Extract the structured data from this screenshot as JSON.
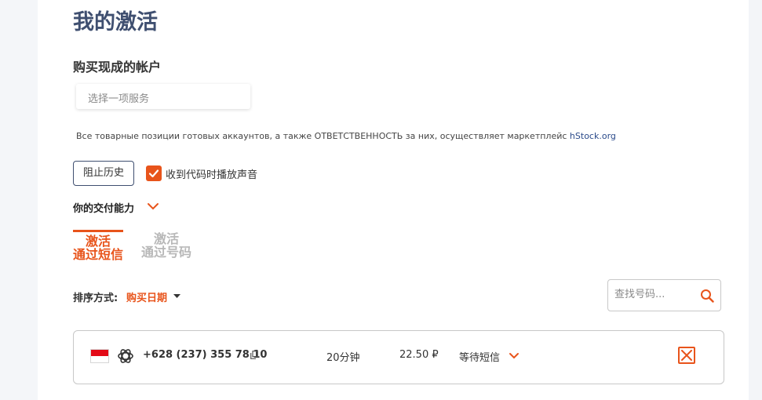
{
  "page": {
    "title": "我的激活",
    "subtitle": "购买现成的帐户",
    "service_select_placeholder": "选择一项服务",
    "notice_text": "Все товарные позиции готовых аккаунтов, а также ОТВЕТСТВЕННОСТЬ за них, осуществляет маркетплейс ",
    "notice_link": "hStock.org",
    "history_button": "阻止历史",
    "sound_checkbox_label": "收到代码时播放声音",
    "sound_checked": true,
    "delivery_ability_label": "你的交付能力"
  },
  "tabs": [
    {
      "line1": "激活",
      "line2": "通过短信",
      "active": true
    },
    {
      "line1": "激活",
      "line2": "通过号码",
      "active": false
    }
  ],
  "sort": {
    "label": "排序方式:",
    "value": "购买日期"
  },
  "search": {
    "placeholder": "查找号码..."
  },
  "activations": [
    {
      "country_flag": "indonesia-flag",
      "service_icon": "openai-icon",
      "phone": "+628 (237) 355 78 10",
      "duration": "20分钟",
      "price": "22.50 ₽",
      "status": "等待短信"
    }
  ],
  "colors": {
    "accent": "#e8541b",
    "title": "#3f4f70",
    "border": "#c8c8c8"
  }
}
